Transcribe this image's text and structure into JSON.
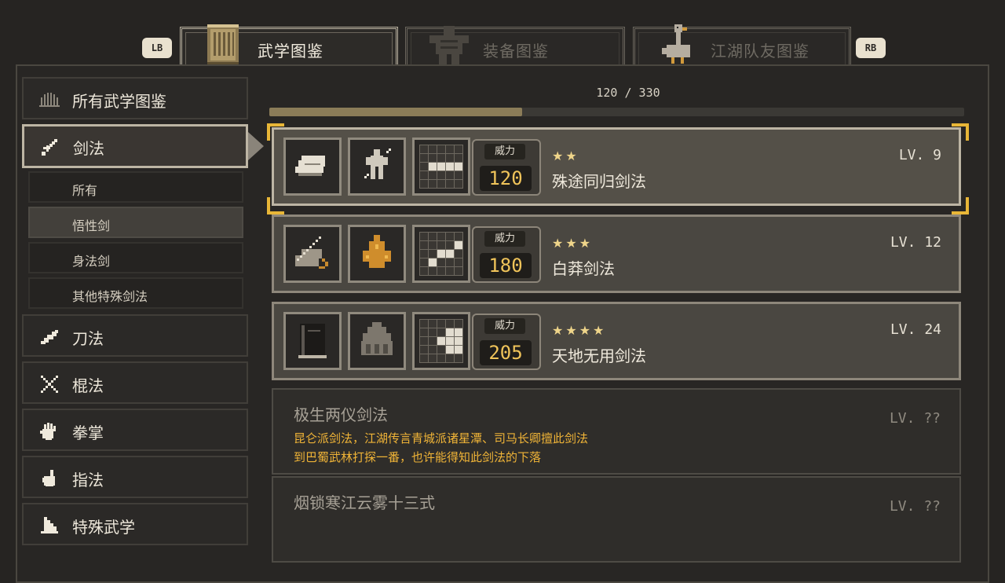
{
  "top_tabs": {
    "left_shoulder": "LB",
    "right_shoulder": "RB",
    "tabs": [
      {
        "label": "武学图鉴",
        "active": true,
        "icon": "scroll-book-icon"
      },
      {
        "label": "装备图鉴",
        "active": false,
        "icon": "armor-icon"
      },
      {
        "label": "江湖队友图鉴",
        "active": false,
        "icon": "goose-icon"
      }
    ]
  },
  "sidebar": {
    "all_label": "所有武学图鉴",
    "categories": [
      {
        "label": "剑法",
        "icon": "sword-icon",
        "active": true
      },
      {
        "label": "刀法",
        "icon": "blade-icon"
      },
      {
        "label": "棍法",
        "icon": "crossed-staff-icon"
      },
      {
        "label": "拳掌",
        "icon": "palm-icon"
      },
      {
        "label": "指法",
        "icon": "finger-icon"
      },
      {
        "label": "特殊武学",
        "icon": "special-icon"
      }
    ],
    "subcategories": [
      {
        "label": "所有"
      },
      {
        "label": "悟性剑",
        "selected": true
      },
      {
        "label": "身法剑"
      },
      {
        "label": "其他特殊剑法"
      }
    ]
  },
  "progress": {
    "text": "120 / 330",
    "current": 120,
    "total": 330
  },
  "skills": [
    {
      "power_label": "威力",
      "power": "120",
      "stars": "★★",
      "name": "殊途同归剑法",
      "level": "LV. 9",
      "selected": true
    },
    {
      "power_label": "威力",
      "power": "180",
      "stars": "★★★",
      "name": "白莽剑法",
      "level": "LV. 12"
    },
    {
      "power_label": "威力",
      "power": "205",
      "stars": "★★★★",
      "name": "天地无用剑法",
      "level": "LV. 24"
    }
  ],
  "locked_skills": [
    {
      "name": "极生两仪剑法",
      "level": "LV. ??",
      "desc_line1": "昆仑派剑法，江湖传言青城派诸星潭、司马长卿擅此剑法",
      "desc_line2": "到巴蜀武林打探一番，也许能得知此剑法的下落"
    },
    {
      "name": "烟锁寒江云雾十三式",
      "level": "LV. ??",
      "desc_line1": "",
      "desc_line2": ""
    }
  ],
  "colors": {
    "accent_gold": "#f0c45a",
    "hint_orange": "#f0b437",
    "selection_corner": "#e8b637"
  }
}
